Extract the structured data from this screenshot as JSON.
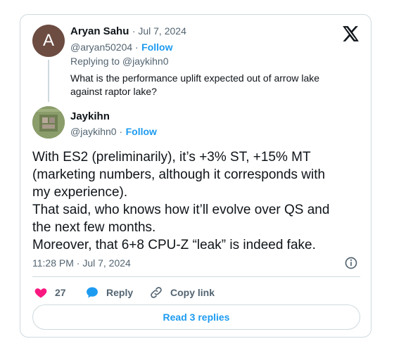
{
  "reply": {
    "author_initial": "A",
    "author_name": "Aryan Sahu",
    "date": "· Jul 7, 2024",
    "handle": "@aryan50204 ·",
    "follow": "Follow",
    "replying_to": "Replying to @jaykihn0",
    "text_line1": "What is the performance uplift expected out of arrow lake",
    "text_line2": "against raptor lake?"
  },
  "tweet": {
    "author_name": "Jaykihn",
    "handle": "@jaykihn0 ·",
    "follow": "Follow",
    "lines": [
      "With ES2 (preliminarily), it’s +3% ST, +15% MT",
      "(marketing numbers, although it corresponds with",
      "my experience).",
      "That said, who knows how it’ll evolve over QS and",
      "the next few months.",
      "Moreover, that 6+8 CPU-Z “leak” is indeed fake."
    ],
    "timestamp": "11:28 PM · Jul 7, 2024"
  },
  "actions": {
    "likes": "27",
    "reply": "Reply",
    "copy_link": "Copy link",
    "read_replies": "Read 3 replies"
  },
  "colors": {
    "accent": "#1d9bf0",
    "like": "#f91880",
    "muted": "#536471",
    "border": "#cfd9de"
  },
  "icons": [
    "x-logo-icon",
    "info-icon",
    "heart-icon",
    "reply-bubble-icon",
    "link-icon"
  ]
}
